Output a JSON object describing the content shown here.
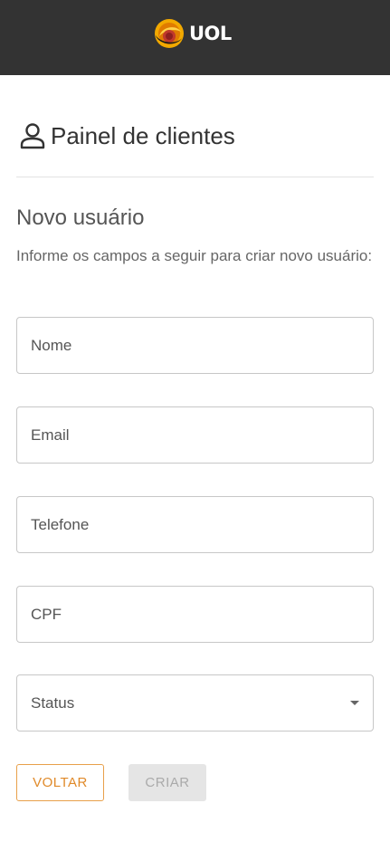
{
  "header": {
    "logo_text": "UOL"
  },
  "page": {
    "title": "Painel de clientes",
    "section_title": "Novo usuário",
    "section_description": "Informe os campos a seguir para criar novo usuário:"
  },
  "form": {
    "name_placeholder": "Nome",
    "email_placeholder": "Email",
    "phone_placeholder": "Telefone",
    "cpf_placeholder": "CPF",
    "status_label": "Status"
  },
  "actions": {
    "back_label": "VOLTAR",
    "create_label": "CRIAR"
  },
  "colors": {
    "topbar": "#333333",
    "accent": "#e08a2a",
    "disabled_button": "#e5e5e5"
  },
  "icons": {
    "logo": "uol-logo-icon",
    "user": "person-icon",
    "dropdown": "caret-down-icon"
  }
}
